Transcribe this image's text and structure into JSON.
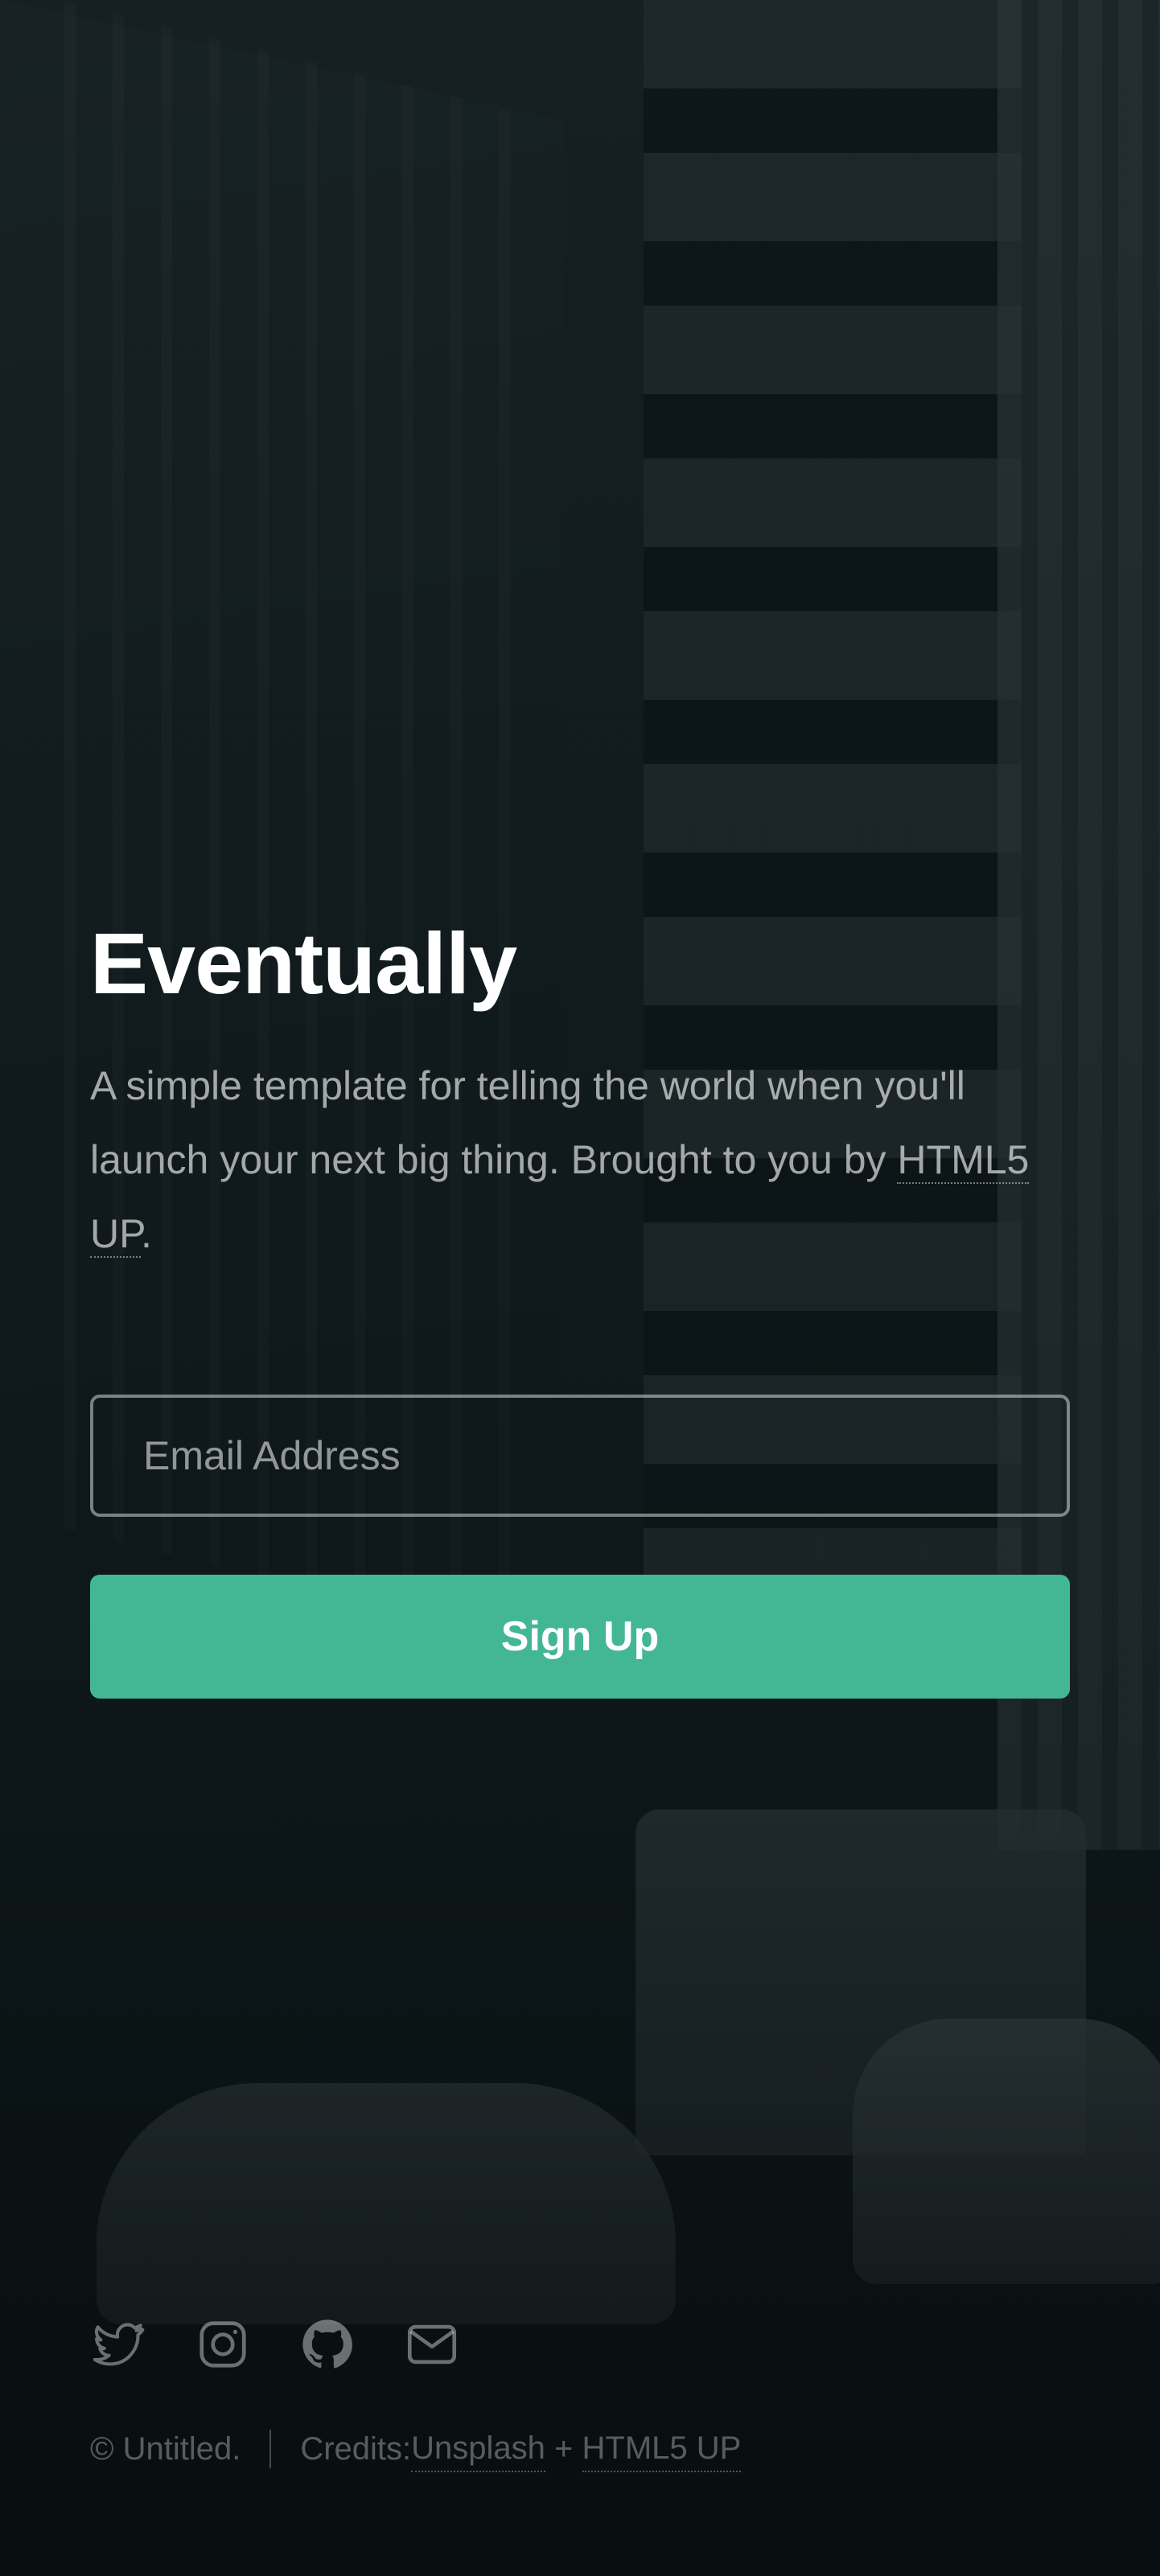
{
  "hero": {
    "title": "Eventually",
    "description_text": "A simple template for telling the world when you'll launch your next big thing. Brought to you by ",
    "description_link": "HTML5 UP",
    "description_end": "."
  },
  "form": {
    "email_placeholder": "Email Address",
    "email_value": "",
    "submit_label": "Sign Up"
  },
  "social": {
    "icons": [
      "twitter-icon",
      "instagram-icon",
      "github-icon",
      "envelope-icon"
    ]
  },
  "footer": {
    "copyright": "© Untitled.",
    "credits_label": "Credits: ",
    "credits_link_1": "Unsplash",
    "credits_join": " + ",
    "credits_link_2": "HTML5 UP"
  },
  "colors": {
    "accent": "#43b794",
    "text": "#ffffff"
  }
}
